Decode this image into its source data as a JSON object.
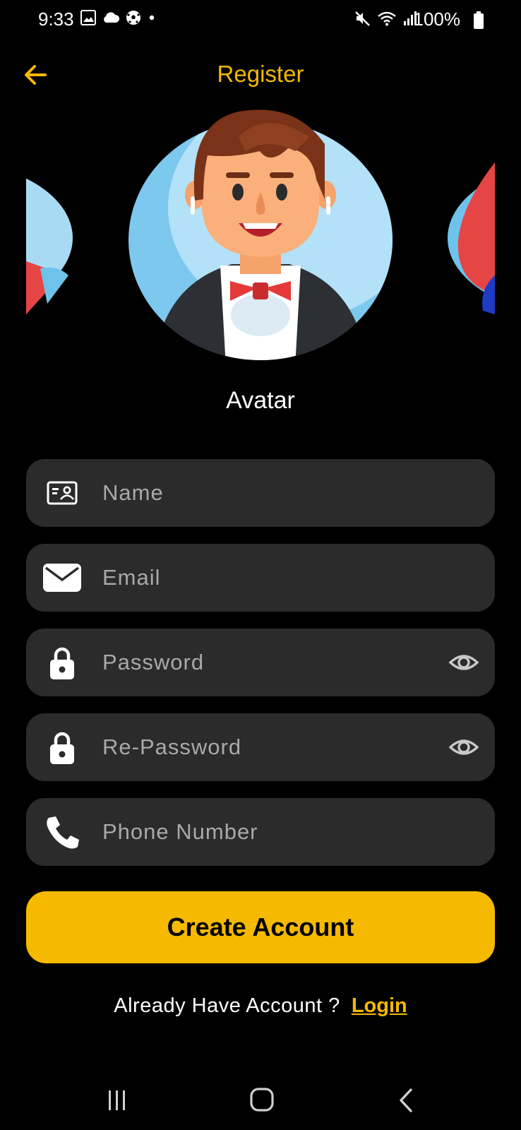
{
  "status_bar": {
    "time": "9:33",
    "battery": "100%",
    "left_icons": [
      "gallery-icon",
      "cloud-icon",
      "soccer-ball-icon",
      "dot-icon"
    ],
    "right_icons": [
      "mute-icon",
      "wifi-icon",
      "signal-icon",
      "battery-icon"
    ]
  },
  "header": {
    "title": "Register",
    "back_icon": "arrow-left-icon"
  },
  "avatar": {
    "label": "Avatar"
  },
  "form": {
    "name_placeholder": "Name",
    "email_placeholder": "Email",
    "password_placeholder": "Password",
    "repassword_placeholder": "Re-Password",
    "phone_placeholder": "Phone Number"
  },
  "actions": {
    "create_label": "Create Account",
    "login_question": "Already Have Account ?",
    "login_link": "Login"
  },
  "nav": {
    "icons": [
      "recents-icon",
      "home-icon",
      "back-icon"
    ]
  },
  "colors": {
    "accent": "#F5B900",
    "background": "#000000",
    "field_bg": "#2A2B2A",
    "placeholder": "#A9A9A9"
  }
}
